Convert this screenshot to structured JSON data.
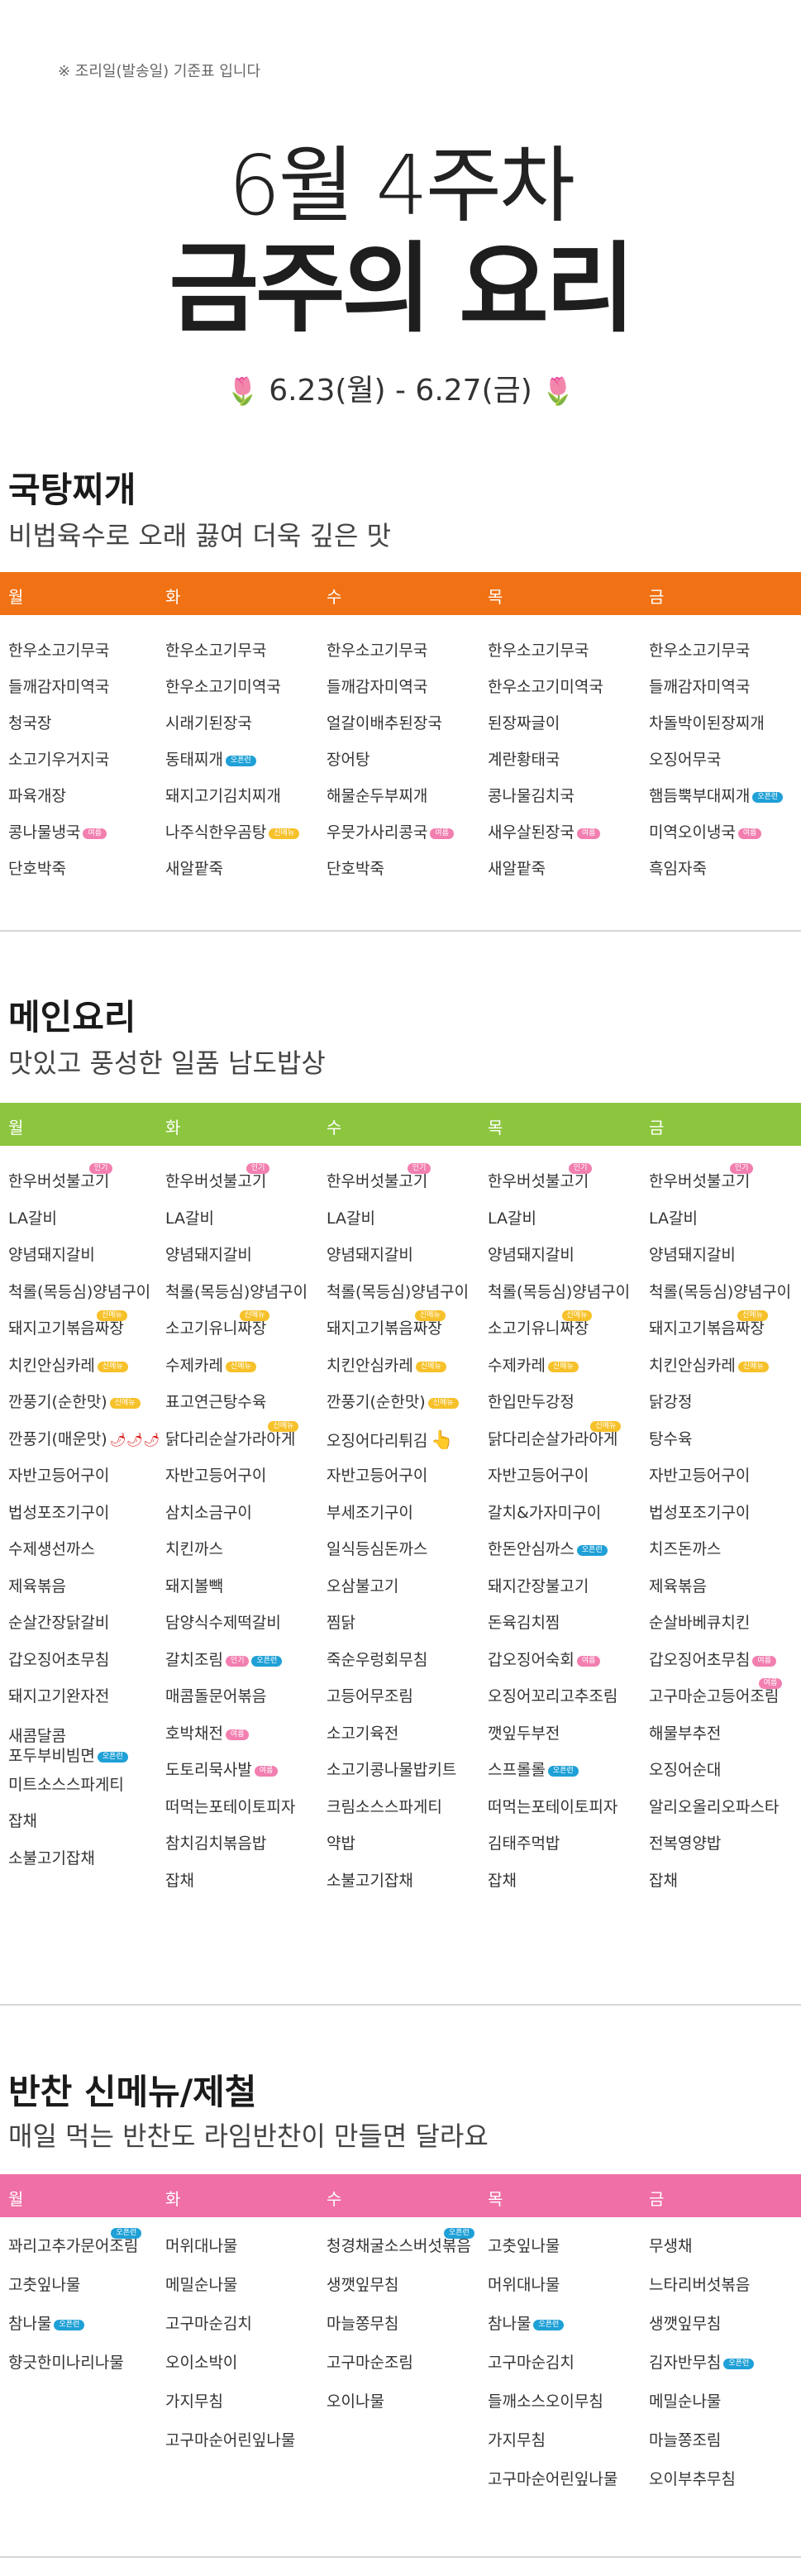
{
  "header": {
    "notice": "※ 조리일(발송일) 기준표 입니다",
    "week": "6월 4주차",
    "title": "금주의 요리",
    "date_range": "6.23(월) - 6.27(금)",
    "flower_icon": "🌷"
  },
  "days": [
    "월",
    "화",
    "수",
    "목",
    "금"
  ],
  "colors": {
    "orange": "#f07214",
    "green": "#8cc63f",
    "pink": "#ef6fa6",
    "badge_pink": "#f27fb0",
    "badge_blue": "#1fa0d6",
    "badge_yellow": "#f6c12a"
  },
  "sections": [
    {
      "title": "국탕찌개",
      "subtitle": "비법육수로 오래 끓여 더욱 깊은 맛",
      "bar_color": "orange",
      "columns": [
        [
          {
            "name": "한우소고기무국"
          },
          {
            "name": "들깨감자미역국"
          },
          {
            "name": "청국장"
          },
          {
            "name": "소고기우거지국"
          },
          {
            "name": "파육개장"
          },
          {
            "name": "콩나물냉국",
            "badge": "여름",
            "badge_color": "pink"
          },
          {
            "name": "단호박죽"
          }
        ],
        [
          {
            "name": "한우소고기무국"
          },
          {
            "name": "한우소고기미역국"
          },
          {
            "name": "시래기된장국"
          },
          {
            "name": "동태찌개",
            "badge": "오픈런",
            "badge_color": "blue"
          },
          {
            "name": "돼지고기김치찌개"
          },
          {
            "name": "나주식한우곰탕",
            "badge": "신메뉴",
            "badge_color": "yellow"
          },
          {
            "name": "새알팥죽"
          }
        ],
        [
          {
            "name": "한우소고기무국"
          },
          {
            "name": "들깨감자미역국"
          },
          {
            "name": "얼갈이배추된장국"
          },
          {
            "name": "장어탕"
          },
          {
            "name": "해물순두부찌개"
          },
          {
            "name": "우뭇가사리콩국",
            "badge": "여름",
            "badge_color": "pink"
          },
          {
            "name": "단호박죽"
          }
        ],
        [
          {
            "name": "한우소고기무국"
          },
          {
            "name": "한우소고기미역국"
          },
          {
            "name": "된장짜글이"
          },
          {
            "name": "계란황태국"
          },
          {
            "name": "콩나물김치국"
          },
          {
            "name": "새우살된장국",
            "badge": "여름",
            "badge_color": "pink"
          },
          {
            "name": "새알팥죽"
          }
        ],
        [
          {
            "name": "한우소고기무국"
          },
          {
            "name": "들깨감자미역국"
          },
          {
            "name": "차돌박이된장찌개"
          },
          {
            "name": "오징어무국"
          },
          {
            "name": "햄듬뿍부대찌개",
            "badge": "오픈런",
            "badge_color": "blue"
          },
          {
            "name": "미역오이냉국",
            "badge": "여름",
            "badge_color": "pink"
          },
          {
            "name": "흑임자죽"
          }
        ]
      ]
    },
    {
      "title": "메인요리",
      "subtitle": "맛있고 풍성한 일품 남도밥상",
      "bar_color": "green",
      "columns": [
        [
          {
            "name": "한우버섯불고기",
            "top_badge": "인기",
            "top_color": "pink"
          },
          {
            "name": "LA갈비"
          },
          {
            "name": "양념돼지갈비"
          },
          {
            "name": "척롤(목등심)양념구이"
          },
          {
            "name": "돼지고기볶음짜장",
            "top_badge": "신메뉴",
            "top_color": "yellow"
          },
          {
            "name": "치킨안심카레",
            "badge": "신메뉴",
            "badge_color": "yellow"
          },
          {
            "name": "깐풍기(순한맛)",
            "badge": "신메뉴",
            "badge_color": "yellow"
          },
          {
            "name": "깐풍기(매운맛)",
            "badge": "🌶🌶🌶",
            "badge_color": "chili"
          },
          {
            "name": "자반고등어구이"
          },
          {
            "name": "법성포조기구이"
          },
          {
            "name": "수제생선까스"
          },
          {
            "name": "제육볶음"
          },
          {
            "name": "순살간장닭갈비"
          },
          {
            "name": "갑오징어초무침"
          },
          {
            "name": "돼지고기완자전"
          },
          {
            "name": "새콤달콤",
            "line2": "포두부비빔면",
            "badge": "오픈런",
            "badge_color": "blue"
          },
          {
            "name": "미트소스스파게티"
          },
          {
            "name": "잡채"
          },
          {
            "name": "소불고기잡채"
          }
        ],
        [
          {
            "name": "한우버섯불고기",
            "top_badge": "인기",
            "top_color": "pink"
          },
          {
            "name": "LA갈비"
          },
          {
            "name": "양념돼지갈비"
          },
          {
            "name": "척롤(목등심)양념구이"
          },
          {
            "name": "소고기유니짜장",
            "top_badge": "신메뉴",
            "top_color": "yellow"
          },
          {
            "name": "수제카레",
            "badge": "신메뉴",
            "badge_color": "yellow"
          },
          {
            "name": "표고연근탕수육"
          },
          {
            "name": "닭다리순살가라아게",
            "top_badge": "신메뉴",
            "top_color": "yellow"
          },
          {
            "name": "자반고등어구이"
          },
          {
            "name": "삼치소금구이"
          },
          {
            "name": "치킨까스"
          },
          {
            "name": "돼지볼빽"
          },
          {
            "name": "담양식수제떡갈비"
          },
          {
            "name": "갈치조림",
            "badge": "인기",
            "badge_color": "pink",
            "badge2": "오픈런",
            "badge2_color": "blue"
          },
          {
            "name": "매콤돌문어볶음"
          },
          {
            "name": "호박채전",
            "badge": "여름",
            "badge_color": "pink"
          },
          {
            "name": "도토리묵사발",
            "badge": "여름",
            "badge_color": "pink"
          },
          {
            "name": "떠먹는포테이토피자"
          },
          {
            "name": "참치김치볶음밥"
          },
          {
            "name": "잡채"
          }
        ],
        [
          {
            "name": "한우버섯불고기",
            "top_badge": "인기",
            "top_color": "pink"
          },
          {
            "name": "LA갈비"
          },
          {
            "name": "양념돼지갈비"
          },
          {
            "name": "척롤(목등심)양념구이"
          },
          {
            "name": "돼지고기볶음짜장",
            "top_badge": "신메뉴",
            "top_color": "yellow"
          },
          {
            "name": "치킨안심카레",
            "badge": "신메뉴",
            "badge_color": "yellow"
          },
          {
            "name": "깐풍기(순한맛)",
            "badge": "신메뉴",
            "badge_color": "yellow"
          },
          {
            "name": "오징어다리튀김",
            "badge": "👆",
            "badge_color": "hand"
          },
          {
            "name": "자반고등어구이"
          },
          {
            "name": "부세조기구이"
          },
          {
            "name": "일식등심돈까스"
          },
          {
            "name": "오삼불고기"
          },
          {
            "name": "찜닭"
          },
          {
            "name": "죽순우렁회무침"
          },
          {
            "name": "고등어무조림"
          },
          {
            "name": "소고기육전"
          },
          {
            "name": "소고기콩나물밥키트"
          },
          {
            "name": "크림소스스파게티"
          },
          {
            "name": "약밥"
          },
          {
            "name": "소불고기잡채"
          }
        ],
        [
          {
            "name": "한우버섯불고기",
            "top_badge": "인기",
            "top_color": "pink"
          },
          {
            "name": "LA갈비"
          },
          {
            "name": "양념돼지갈비"
          },
          {
            "name": "척롤(목등심)양념구이"
          },
          {
            "name": "소고기유니짜장",
            "top_badge": "신메뉴",
            "top_color": "yellow"
          },
          {
            "name": "수제카레",
            "badge": "신메뉴",
            "badge_color": "yellow"
          },
          {
            "name": "한입만두강정"
          },
          {
            "name": "닭다리순살가라아게",
            "top_badge": "신메뉴",
            "top_color": "yellow"
          },
          {
            "name": "자반고등어구이"
          },
          {
            "name": "갈치&가자미구이"
          },
          {
            "name": "한돈안심까스",
            "badge": "오픈런",
            "badge_color": "blue"
          },
          {
            "name": "돼지간장불고기"
          },
          {
            "name": "돈육김치찜"
          },
          {
            "name": "갑오징어숙회",
            "badge": "여름",
            "badge_color": "pink"
          },
          {
            "name": "오징어꼬리고추조림"
          },
          {
            "name": "깻잎두부전"
          },
          {
            "name": "스프롤롤",
            "badge": "오픈런",
            "badge_color": "blue"
          },
          {
            "name": "떠먹는포테이토피자"
          },
          {
            "name": "김태주먹밥"
          },
          {
            "name": "잡채"
          }
        ],
        [
          {
            "name": "한우버섯불고기",
            "top_badge": "인기",
            "top_color": "pink"
          },
          {
            "name": "LA갈비"
          },
          {
            "name": "양념돼지갈비"
          },
          {
            "name": "척롤(목등심)양념구이"
          },
          {
            "name": "돼지고기볶음짜장",
            "top_badge": "신메뉴",
            "top_color": "yellow"
          },
          {
            "name": "치킨안심카레",
            "badge": "신메뉴",
            "badge_color": "yellow"
          },
          {
            "name": "닭강정"
          },
          {
            "name": "탕수육"
          },
          {
            "name": "자반고등어구이"
          },
          {
            "name": "법성포조기구이"
          },
          {
            "name": "치즈돈까스"
          },
          {
            "name": "제육볶음"
          },
          {
            "name": "순살바베큐치킨"
          },
          {
            "name": "갑오징어초무침",
            "badge": "여름",
            "badge_color": "pink"
          },
          {
            "name": "고구마순고등어조림",
            "top_badge": "여름",
            "top_color": "pink"
          },
          {
            "name": "해물부추전"
          },
          {
            "name": "오징어순대"
          },
          {
            "name": "알리오올리오파스타"
          },
          {
            "name": "전복영양밥"
          },
          {
            "name": "잡채"
          }
        ]
      ]
    },
    {
      "title": "반찬 신메뉴/제철",
      "subtitle": "매일 먹는 반찬도 라임반찬이 만들면 달라요",
      "bar_color": "pink",
      "columns": [
        [
          {
            "name": "꽈리고추가문어조림",
            "top_badge": "오픈런",
            "top_color": "blue"
          },
          {
            "name": "고춧잎나물"
          },
          {
            "name": "참나물",
            "badge": "오픈런",
            "badge_color": "blue"
          },
          {
            "name": "향긋한미나리나물"
          }
        ],
        [
          {
            "name": "머위대나물"
          },
          {
            "name": "메밀순나물"
          },
          {
            "name": "고구마순김치"
          },
          {
            "name": "오이소박이"
          },
          {
            "name": "가지무침"
          },
          {
            "name": "고구마순어린잎나물"
          }
        ],
        [
          {
            "name": "청경채굴소스버섯볶음",
            "top_badge": "오픈런",
            "top_color": "blue"
          },
          {
            "name": "생깻잎무침"
          },
          {
            "name": "마늘쫑무침"
          },
          {
            "name": "고구마순조림"
          },
          {
            "name": "오이나물"
          }
        ],
        [
          {
            "name": "고춧잎나물"
          },
          {
            "name": "머위대나물"
          },
          {
            "name": "참나물",
            "badge": "오픈런",
            "badge_color": "blue"
          },
          {
            "name": "고구마순김치"
          },
          {
            "name": "들깨소스오이무침"
          },
          {
            "name": "가지무침"
          },
          {
            "name": "고구마순어린잎나물"
          }
        ],
        [
          {
            "name": "무생채"
          },
          {
            "name": "느타리버섯볶음"
          },
          {
            "name": "생깻잎무침"
          },
          {
            "name": "김자반무침",
            "badge": "오픈런",
            "badge_color": "blue"
          },
          {
            "name": "메밀순나물"
          },
          {
            "name": "마늘쫑조림"
          },
          {
            "name": "오이부추무침"
          }
        ]
      ]
    }
  ]
}
